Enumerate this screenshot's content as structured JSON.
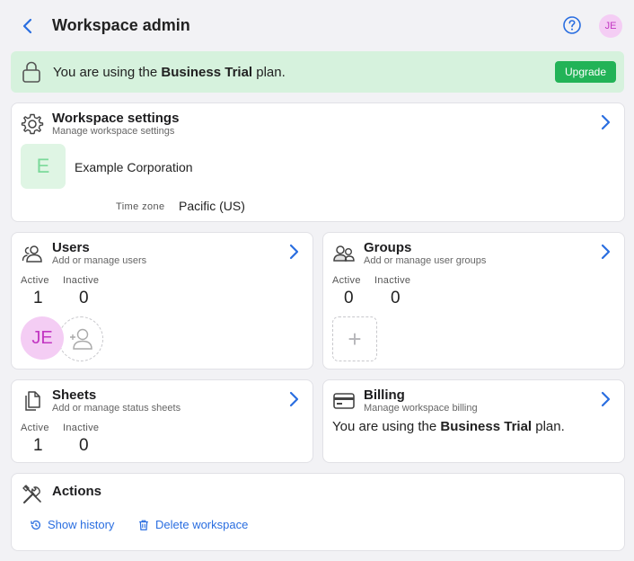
{
  "header": {
    "title": "Workspace admin",
    "avatar_initials": "JE"
  },
  "banner": {
    "prefix": "You are using the ",
    "plan": "Business Trial",
    "suffix": " plan.",
    "upgrade_label": "Upgrade"
  },
  "workspace": {
    "title": "Workspace settings",
    "subtitle": "Manage workspace settings",
    "logo_letter": "E",
    "org_name": "Example Corporation",
    "tz_label": "Time zone",
    "tz_value": "Pacific (US)"
  },
  "users": {
    "title": "Users",
    "subtitle": "Add or manage users",
    "active_label": "Active",
    "active_value": "1",
    "inactive_label": "Inactive",
    "inactive_value": "0",
    "member_initials": "JE"
  },
  "groups": {
    "title": "Groups",
    "subtitle": "Add or manage user groups",
    "active_label": "Active",
    "active_value": "0",
    "inactive_label": "Inactive",
    "inactive_value": "0",
    "add_glyph": "+"
  },
  "sheets": {
    "title": "Sheets",
    "subtitle": "Add or manage status sheets",
    "active_label": "Active",
    "active_value": "1",
    "inactive_label": "Inactive",
    "inactive_value": "0"
  },
  "billing": {
    "title": "Billing",
    "subtitle": "Manage workspace billing",
    "prefix": "You are using the ",
    "plan": "Business Trial",
    "suffix": " plan."
  },
  "actions": {
    "title": "Actions",
    "history_label": "Show history",
    "delete_label": "Delete workspace"
  },
  "colors": {
    "accent": "#2a6ee0",
    "success": "#22b357",
    "banner_bg": "#d6f2dd",
    "avatar_bg": "#f4cdf4",
    "avatar_fg": "#c236c2"
  }
}
